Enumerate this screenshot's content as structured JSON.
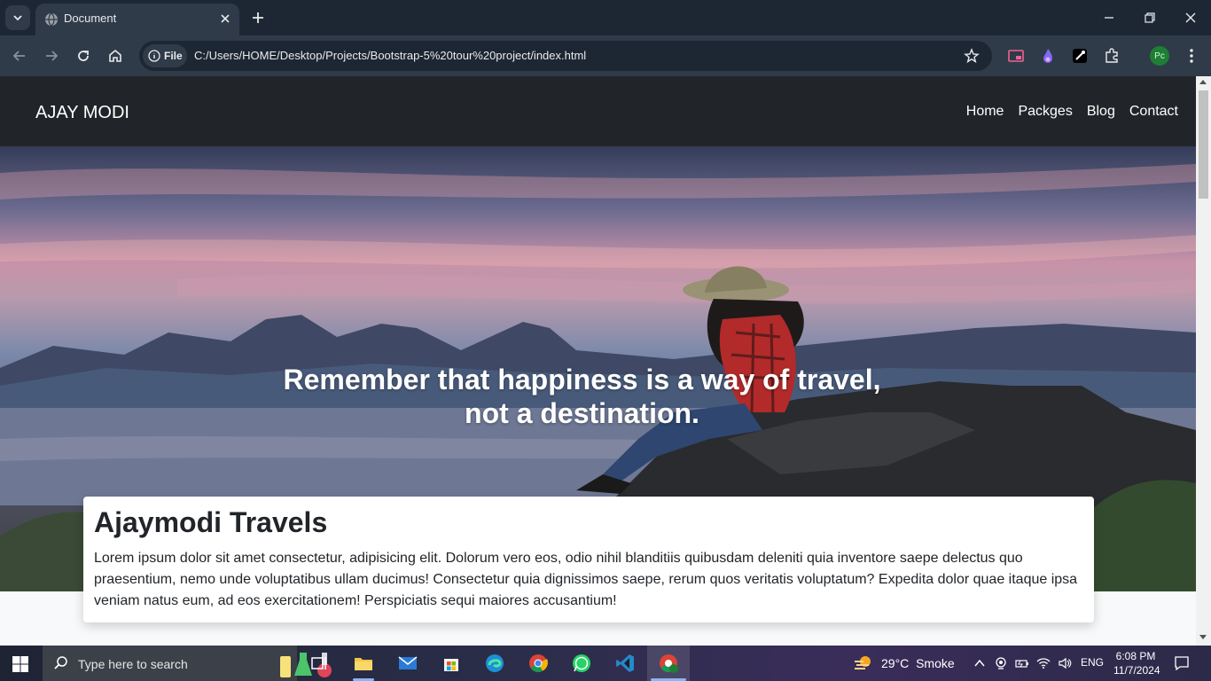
{
  "browser": {
    "tab_title": "Document",
    "omnibox_chip": "File",
    "url": "C:/Users/HOME/Desktop/Projects/Bootstrap-5%20tour%20project/index.html",
    "profile_initials": "Pc"
  },
  "site": {
    "brand": "AJAY MODI",
    "nav": [
      "Home",
      "Packges",
      "Blog",
      "Contact"
    ],
    "hero_quote_line1": "Remember that happiness is a way of travel,",
    "hero_quote_line2": "not a destination.",
    "card_title": "Ajaymodi Travels",
    "card_text": "Lorem ipsum dolor sit amet consectetur, adipisicing elit. Dolorum vero eos, odio nihil blanditiis quibusdam deleniti quia inventore saepe delectus quo praesentium, nemo unde voluptatibus ullam ducimus! Consectetur quia dignissimos saepe, rerum quos veritatis voluptatum? Expedita dolor quae itaque ipsa veniam natus eum, ad eos exercitationem! Perspiciatis sequi maiores accusantium!"
  },
  "taskbar": {
    "search_placeholder": "Type here to search",
    "weather_temp": "29°C",
    "weather_desc": "Smoke",
    "language": "ENG",
    "time": "6:08 PM",
    "date": "11/7/2024"
  },
  "colors": {
    "navbar_bg": "#212529",
    "browser_frame": "#1d2733",
    "profile_badge": "#1e7e34"
  }
}
